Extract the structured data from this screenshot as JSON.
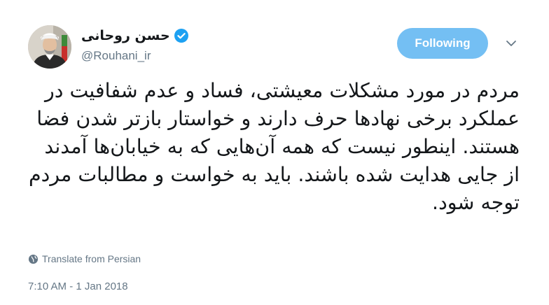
{
  "author": {
    "display_name": "حسن روحانی",
    "handle": "@Rouhani_ir",
    "verified": true
  },
  "follow_button": {
    "label": "Following"
  },
  "tweet": {
    "text": "مردم در مورد مشکلات معیشتی، فساد و عدم شفافیت در عملکرد برخی نهادها حرف دارند و خواستار بازتر شدن فضا هستند. اینطور نیست که همه آن‌هایی که به خیابان‌ها آمدند از جایی هدایت شده باشند. باید به خواست و مطالبات مردم توجه شود.",
    "translate_label": "Translate from Persian",
    "timestamp": "7:10 AM - 1 Jan 2018"
  },
  "icons": {
    "verified": "verified-badge-icon",
    "caret": "chevron-down-icon",
    "translate": "globe-icon"
  },
  "colors": {
    "follow_button_bg": "#74bff3",
    "verified_badge": "#1da1f2",
    "secondary_text": "#657786",
    "primary_text": "#14171a"
  }
}
